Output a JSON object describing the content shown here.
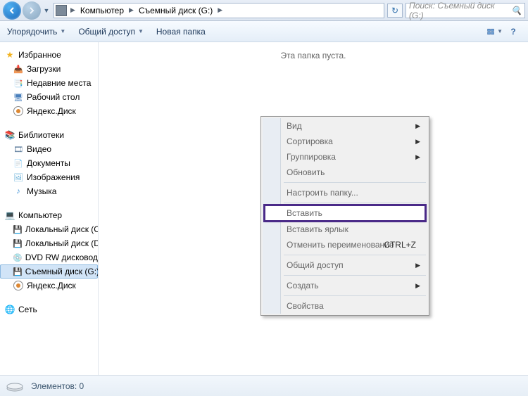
{
  "address": {
    "segments": [
      "Компьютер",
      "Съемный диск (G:)"
    ]
  },
  "search": {
    "placeholder": "Поиск: Съемный диск (G:)"
  },
  "toolbar": {
    "organize": "Упорядочить",
    "share": "Общий доступ",
    "newfolder": "Новая папка"
  },
  "sidebar": {
    "favorites": {
      "label": "Избранное",
      "items": [
        "Загрузки",
        "Недавние места",
        "Рабочий стол",
        "Яндекс.Диск"
      ]
    },
    "libraries": {
      "label": "Библиотеки",
      "items": [
        "Видео",
        "Документы",
        "Изображения",
        "Музыка"
      ]
    },
    "computer": {
      "label": "Компьютер",
      "items": [
        "Локальный диск (C:)",
        "Локальный диск (D:)",
        "DVD RW дисковод (",
        "Съемный диск (G:)",
        "Яндекс.Диск"
      ]
    },
    "network": {
      "label": "Сеть"
    }
  },
  "content": {
    "empty": "Эта папка пуста."
  },
  "contextmenu": {
    "view": "Вид",
    "sort": "Сортировка",
    "group": "Группировка",
    "refresh": "Обновить",
    "customize": "Настроить папку...",
    "paste": "Вставить",
    "pasteshortcut": "Вставить ярлык",
    "undo_rename": "Отменить переименование",
    "undo_shortcut": "CTRL+Z",
    "shareaccess": "Общий доступ",
    "create": "Создать",
    "properties": "Свойства"
  },
  "status": {
    "items": "Элементов: 0"
  }
}
